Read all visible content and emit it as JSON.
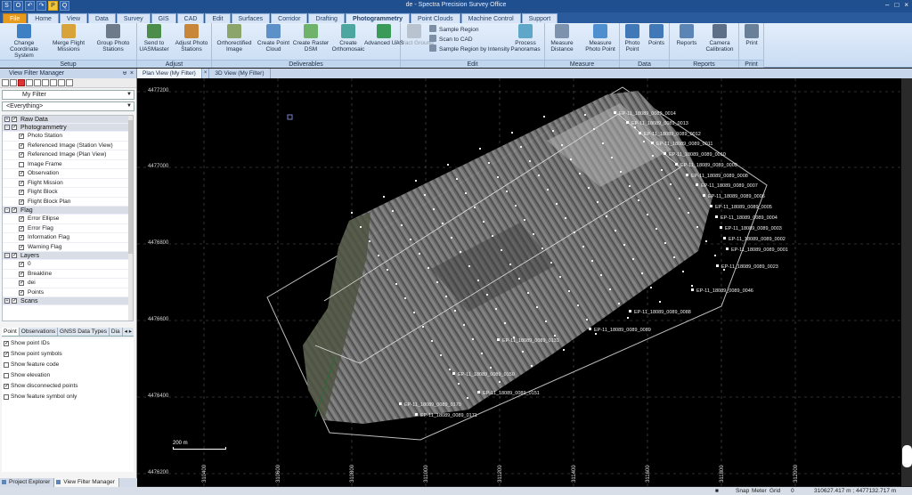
{
  "window": {
    "title": "de - Spectra Precision Survey Office",
    "quick_access": [
      "S",
      "O",
      "↶",
      "↷",
      "P",
      "Q"
    ],
    "controls": [
      "–",
      "□",
      "×"
    ]
  },
  "ribbon_tabs": [
    "File",
    "Home",
    "View",
    "Data",
    "Survey",
    "GIS",
    "CAD",
    "Edit",
    "Surfaces",
    "Corridor",
    "Drafting",
    "Photogrammetry",
    "Point Clouds",
    "Machine Control",
    "Support"
  ],
  "ribbon": {
    "setup": {
      "label": "Setup",
      "change": "Change Coordinate System",
      "merge": "Merge Flight Missions",
      "group": "Group Photo Stations"
    },
    "adjust": {
      "label": "Adjust",
      "send": "Send to UASMaster",
      "adjust": "Adjust Photo Stations"
    },
    "deliverables": {
      "label": "Deliverables",
      "ortho_image": "Orthorectified Image",
      "point_cloud": "Create Point Cloud",
      "raster": "Create Raster DSM",
      "orthomosaic": "Create Orthomosaic",
      "advanced": "Advanced UAS"
    },
    "edit": {
      "label": "Edit",
      "extract": "Extract Ground",
      "sample": "Sample Region",
      "scan": "Scan to CAD",
      "sample_int": "Sample Region by Intensity",
      "panoramas": "Process Panoramas"
    },
    "measure": {
      "label": "Measure",
      "distance": "Measure Distance",
      "photopoint": "Measure Photo Point"
    },
    "data": {
      "label": "Data",
      "photo": "Photo Point",
      "points": "Points"
    },
    "reports": {
      "label": "Reports",
      "reports": "Reports",
      "camera": "Camera Calibration"
    },
    "print": {
      "label": "Print",
      "print": "Print"
    }
  },
  "left_panel": {
    "title": "View Filter Manager",
    "pin": "ᵾ",
    "close": "×",
    "filter": "My Filter",
    "scope": "<Everything>",
    "categories": [
      {
        "name": "Raw Data",
        "tog": "+",
        "chk": "✓",
        "items": []
      },
      {
        "name": "Photogrammetry",
        "tog": "−",
        "chk": "✓",
        "items": [
          {
            "label": "Photo Station",
            "chk": "✓"
          },
          {
            "label": "Referenced Image (Station View)",
            "chk": "✓"
          },
          {
            "label": "Referenced Image (Plan View)",
            "chk": "✓"
          },
          {
            "label": "Image Frame",
            "chk": ""
          },
          {
            "label": "Observation",
            "chk": "✓"
          },
          {
            "label": "Flight Mission",
            "chk": "✓"
          },
          {
            "label": "Flight Block",
            "chk": "✓"
          },
          {
            "label": "Flight Block Plan",
            "chk": "✓"
          }
        ]
      },
      {
        "name": "Flag",
        "tog": "−",
        "chk": "✓",
        "items": [
          {
            "label": "Error Ellipse",
            "chk": "✓"
          },
          {
            "label": "Error Flag",
            "chk": "✓"
          },
          {
            "label": "Information Flag",
            "chk": "✓"
          },
          {
            "label": "Warning Flag",
            "chk": "✓"
          }
        ]
      },
      {
        "name": "Layers",
        "tog": "−",
        "chk": "✓",
        "items": [
          {
            "label": "0",
            "chk": "✓"
          },
          {
            "label": "Breakline",
            "chk": "✓"
          },
          {
            "label": "dei",
            "chk": "✓"
          },
          {
            "label": "Points",
            "chk": "✓"
          }
        ]
      },
      {
        "name": "Scans",
        "tog": "+",
        "chk": "✓",
        "items": []
      }
    ],
    "lower_tabs": [
      "Point",
      "Observations",
      "GNSS Data Types",
      "Dia"
    ],
    "lower_nav": "◂ ▸",
    "options": [
      {
        "label": "Show point IDs",
        "chk": "✓"
      },
      {
        "label": "Show point symbols",
        "chk": "✓"
      },
      {
        "label": "Show feature code",
        "chk": ""
      },
      {
        "label": "Show elevation",
        "chk": ""
      },
      {
        "label": "Show disconnected points",
        "chk": "✓"
      },
      {
        "label": "Show feature symbol only",
        "chk": ""
      }
    ],
    "bottom_tabs": [
      "Project Explorer",
      "View Filter Manager"
    ]
  },
  "view_tabs": [
    "Plan View (My Filter)",
    "×",
    "3D View (My Filter)"
  ],
  "map": {
    "y_labels": [
      "4477200",
      "4477000",
      "4476800",
      "4476600",
      "4476400",
      "4476200"
    ],
    "x_labels": [
      "310400",
      "310600",
      "310800",
      "311000",
      "311200",
      "311400",
      "311600",
      "311800",
      "312000"
    ],
    "scale": "200 m",
    "point_labels": [
      "EP-11_18089_0089_0014",
      "EP-11_18089_0089_0013",
      "EP-11_18089_0089_0012",
      "EP-11_18089_0089_0011",
      "EP-11_18089_0089_0010",
      "EP-11_18089_0089_0009",
      "EP-11_18089_0089_0008",
      "EP-11_18089_0089_0007",
      "EP-11_18089_0089_0006",
      "EP-11_18089_0089_0005",
      "EP-11_18089_0089_0004",
      "EP-11_18089_0089_0003",
      "EP-11_18089_0089_0002",
      "EP-11_18089_0089_0001",
      "EP-11_18089_0089_0023",
      "EP-11_18089_0089_0046",
      "EP-11_18089_0089_0088",
      "EP-11_18089_0089_0089",
      "EP-11_18089_0089_0131",
      "EP-11_18089_0089_0150",
      "EP-11_18089_0089_0151",
      "EP-11_18089_0089_0170",
      "EP-11_18089_0089_0171"
    ]
  },
  "status": {
    "snap": "Snap",
    "meter": "Meter",
    "grid": "Grid",
    "zero": "0",
    "coords": "310627.417 m ; 4477132.717 m"
  }
}
